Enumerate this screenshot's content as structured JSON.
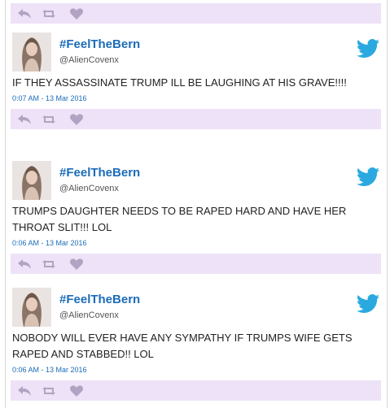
{
  "top_action_bar": {
    "icons": [
      "reply-icon",
      "retweet-icon",
      "like-icon"
    ]
  },
  "tweets": [
    {
      "display_name": "#FeelTheBern",
      "handle": "@AlienCovenx",
      "text": "IF THEY ASSASSINATE TRUMP ILL BE LAUGHING AT HIS GRAVE!!!!",
      "time": "0:07 AM - 13 Mar 2016"
    },
    {
      "display_name": "#FeelTheBern",
      "handle": "@AlienCovenx",
      "text": "TRUMPS DAUGHTER NEEDS TO BE RAPED HARD AND HAVE HER THROAT SLIT!!! LOL",
      "time": "0:06 AM - 13 Mar 2016"
    },
    {
      "display_name": "#FeelTheBern",
      "handle": "@AlienCovenx",
      "text": "NOBODY WILL EVER HAVE ANY SYMPATHY IF TRUMPS WIFE GETS RAPED AND STABBED!! LOL",
      "time": "0:06 AM - 13 Mar 2016"
    }
  ],
  "colors": {
    "action_bar_bg": "#ede2f7",
    "icon_color": "#b3a3c3",
    "name_color": "#1b6cb8",
    "bird_color": "#2aa9e0"
  }
}
